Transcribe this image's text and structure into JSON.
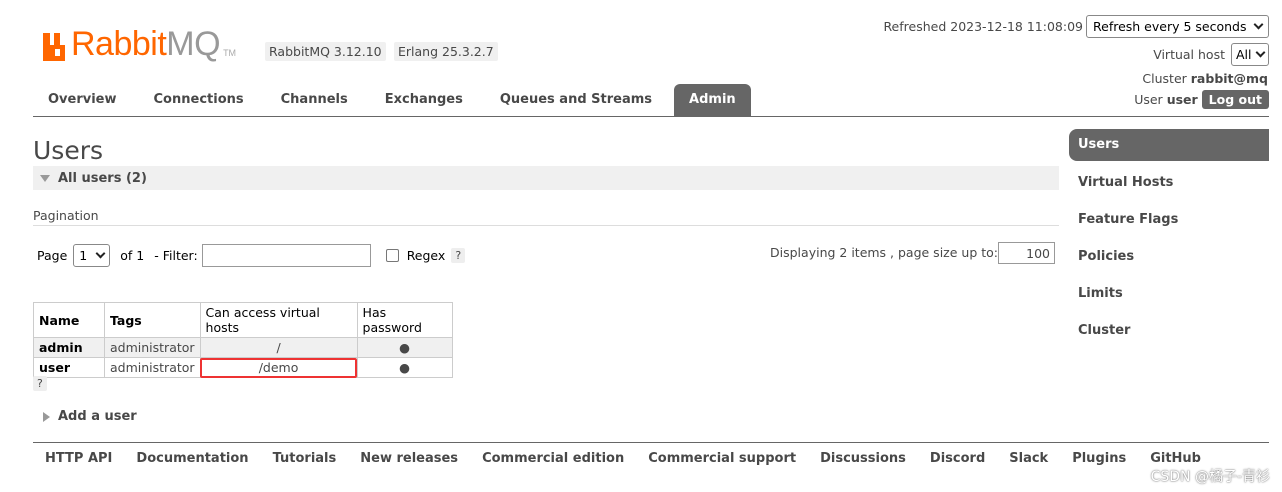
{
  "app": {
    "brand_rabbit": "Rabbit",
    "brand_mq": "MQ",
    "brand_tm": "TM",
    "rabbit_version": "RabbitMQ 3.12.10",
    "erlang_version": "Erlang 25.3.2.7"
  },
  "status": {
    "refreshed": "Refreshed 2023-12-18 11:08:09",
    "refresh_select": "Refresh every 5 seconds",
    "vhost_label": "Virtual host",
    "vhost_select": "All",
    "cluster_label": "Cluster",
    "cluster_name": "rabbit@mq",
    "user_label": "User",
    "user_name": "user",
    "logout": "Log out"
  },
  "tabs": [
    {
      "label": "Overview"
    },
    {
      "label": "Connections"
    },
    {
      "label": "Channels"
    },
    {
      "label": "Exchanges"
    },
    {
      "label": "Queues and Streams"
    },
    {
      "label": "Admin",
      "active": true
    }
  ],
  "sidenav": [
    {
      "label": "Users",
      "active": true
    },
    {
      "label": "Virtual Hosts"
    },
    {
      "label": "Feature Flags"
    },
    {
      "label": "Policies"
    },
    {
      "label": "Limits"
    },
    {
      "label": "Cluster"
    }
  ],
  "main": {
    "title": "Users",
    "section": "All users (2)",
    "pagination_label": "Pagination",
    "page_label": "Page",
    "page_value": "1",
    "of_label": "of 1",
    "filter_label": "- Filter:",
    "filter_value": "",
    "regex_label": "Regex",
    "help": "?",
    "displaying": "Displaying 2 items , page size up to:",
    "page_size": "100",
    "add_user": "Add a user"
  },
  "table": {
    "headers": [
      "Name",
      "Tags",
      "Can access virtual hosts",
      "Has password"
    ],
    "rows": [
      {
        "name": "admin",
        "tags": "administrator",
        "vhosts": "/",
        "password": "●"
      },
      {
        "name": "user",
        "tags": "administrator",
        "vhosts": "/demo",
        "password": "●"
      }
    ]
  },
  "footer": [
    "HTTP API",
    "Documentation",
    "Tutorials",
    "New releases",
    "Commercial edition",
    "Commercial support",
    "Discussions",
    "Discord",
    "Slack",
    "Plugins",
    "GitHub"
  ],
  "watermark": "CSDN @橘子-青衫",
  "colors": {
    "brand_orange": "#ff6600",
    "tab_active": "#666666",
    "highlight": "#e33333"
  }
}
